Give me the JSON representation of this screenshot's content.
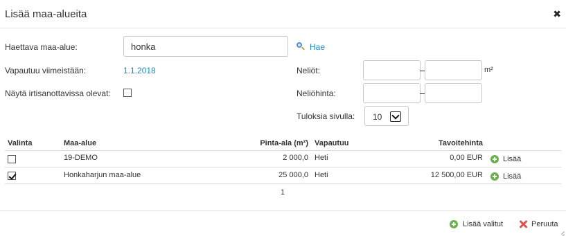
{
  "dialog": {
    "title": "Lisää maa-alueita",
    "close_label": "✖"
  },
  "form": {
    "search_label": "Haettava maa-alue:",
    "search_value": "honka",
    "search_button": "Hae",
    "released_label": "Vapautuu viimeistään:",
    "released_value": "1.1.2018",
    "show_terminated_label": "Näytä irtisanottavissa olevat:",
    "area_label": "Neliöt:",
    "area_min": "",
    "area_max": "",
    "area_unit": "m²",
    "price_label": "Neliöhinta:",
    "price_min": "",
    "price_max": "",
    "per_page_label": "Tuloksia sivulla:",
    "per_page_value": "10"
  },
  "table": {
    "headers": {
      "select": "Valinta",
      "area": "Maa-alue",
      "size": "Pinta-ala (m²)",
      "released": "Vapautuu",
      "target_price": "Tavoitehinta"
    },
    "rows": [
      {
        "checked": false,
        "area": "19-DEMO",
        "size": "2 000,0",
        "released": "Heti",
        "target_price": "0,00 EUR",
        "action": "Lisää"
      },
      {
        "checked": true,
        "area": "Honkaharjun maa-alue",
        "size": "25 000,0",
        "released": "Heti",
        "target_price": "12 500,00 EUR",
        "action": "Lisää"
      }
    ],
    "page": "1"
  },
  "footer": {
    "add_selected": "Lisää valitut",
    "cancel": "Peruuta"
  },
  "colors": {
    "link": "#1a8bc5",
    "add_icon": "#6ab04c",
    "cancel_icon": "#d9534f"
  }
}
